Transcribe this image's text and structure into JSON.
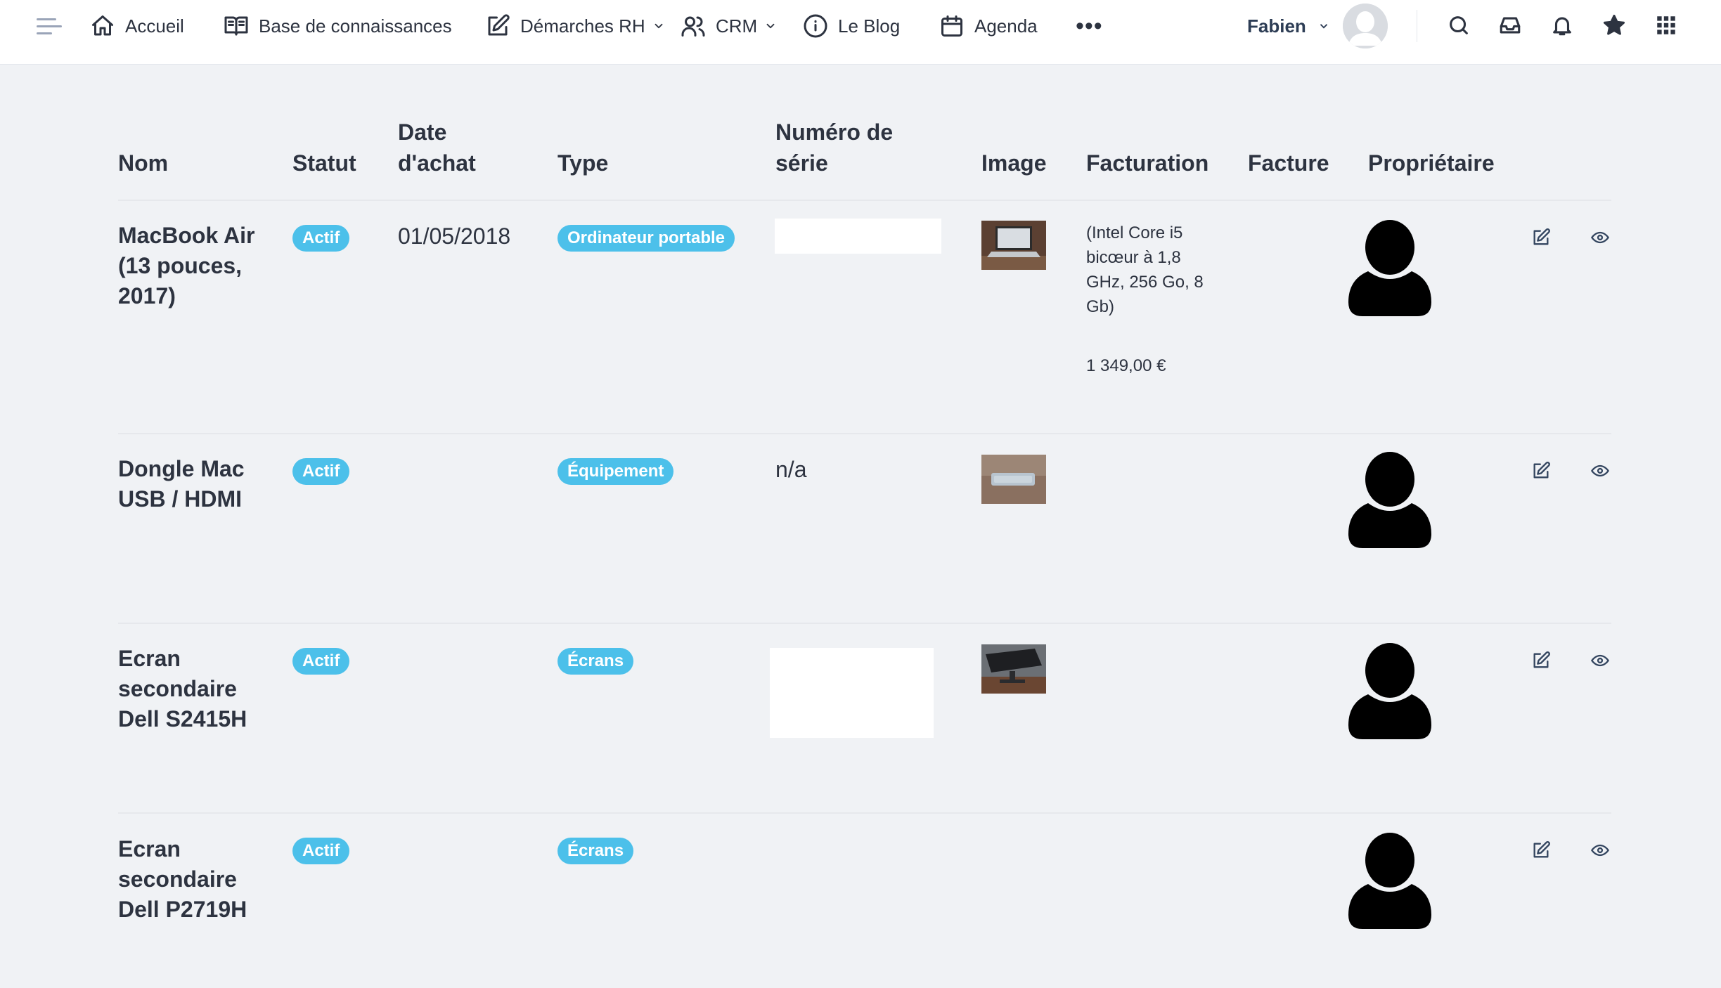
{
  "nav": {
    "items": [
      {
        "label": "Accueil",
        "icon": "home-icon"
      },
      {
        "label": "Base de connaissances",
        "icon": "book-icon"
      },
      {
        "label": "Démarches RH",
        "icon": "edit-icon",
        "dropdown": true
      },
      {
        "label": "CRM",
        "icon": "users-icon",
        "dropdown": true
      },
      {
        "label": "Le Blog",
        "icon": "info-icon"
      },
      {
        "label": "Agenda",
        "icon": "calendar-icon"
      }
    ],
    "more": "•••",
    "user_name": "Fabien",
    "right_icons": [
      "search-icon",
      "inbox-icon",
      "bell-icon",
      "star-icon",
      "apps-grid-icon"
    ]
  },
  "table": {
    "headers": {
      "nom": "Nom",
      "statut": "Statut",
      "date": [
        "Date",
        "d'achat"
      ],
      "type": "Type",
      "serie": [
        "Numéro de",
        "série"
      ],
      "image": "Image",
      "facturation": "Facturation",
      "facture": "Facture",
      "proprietaire": "Propriétaire"
    },
    "rows": [
      {
        "name": [
          "MacBook Air",
          "(13 pouces,",
          "2017)"
        ],
        "status": "Actif",
        "date": "01/05/2018",
        "type": "Ordinateur portable",
        "serial": "",
        "billing": [
          "(Intel Core i5",
          "bicœur à 1,8",
          "GHz, 256 Go, 8",
          "Gb)"
        ],
        "price": "1 349,00 €"
      },
      {
        "name": [
          "Dongle Mac",
          "USB / HDMI"
        ],
        "status": "Actif",
        "date": "",
        "type": "Équipement",
        "serial": "n/a",
        "billing": [],
        "price": ""
      },
      {
        "name": [
          "Ecran",
          "secondaire",
          "Dell S2415H"
        ],
        "status": "Actif",
        "date": "",
        "type": "Écrans",
        "serial": "",
        "billing": [],
        "price": ""
      },
      {
        "name": [
          "Ecran",
          "secondaire",
          "Dell P2719H"
        ],
        "status": "Actif",
        "date": "",
        "type": "Écrans",
        "serial": "",
        "billing": [],
        "price": ""
      }
    ]
  },
  "colors": {
    "badge": "#4cc0ea",
    "background": "#f0f2f5",
    "text": "#2d3340"
  }
}
